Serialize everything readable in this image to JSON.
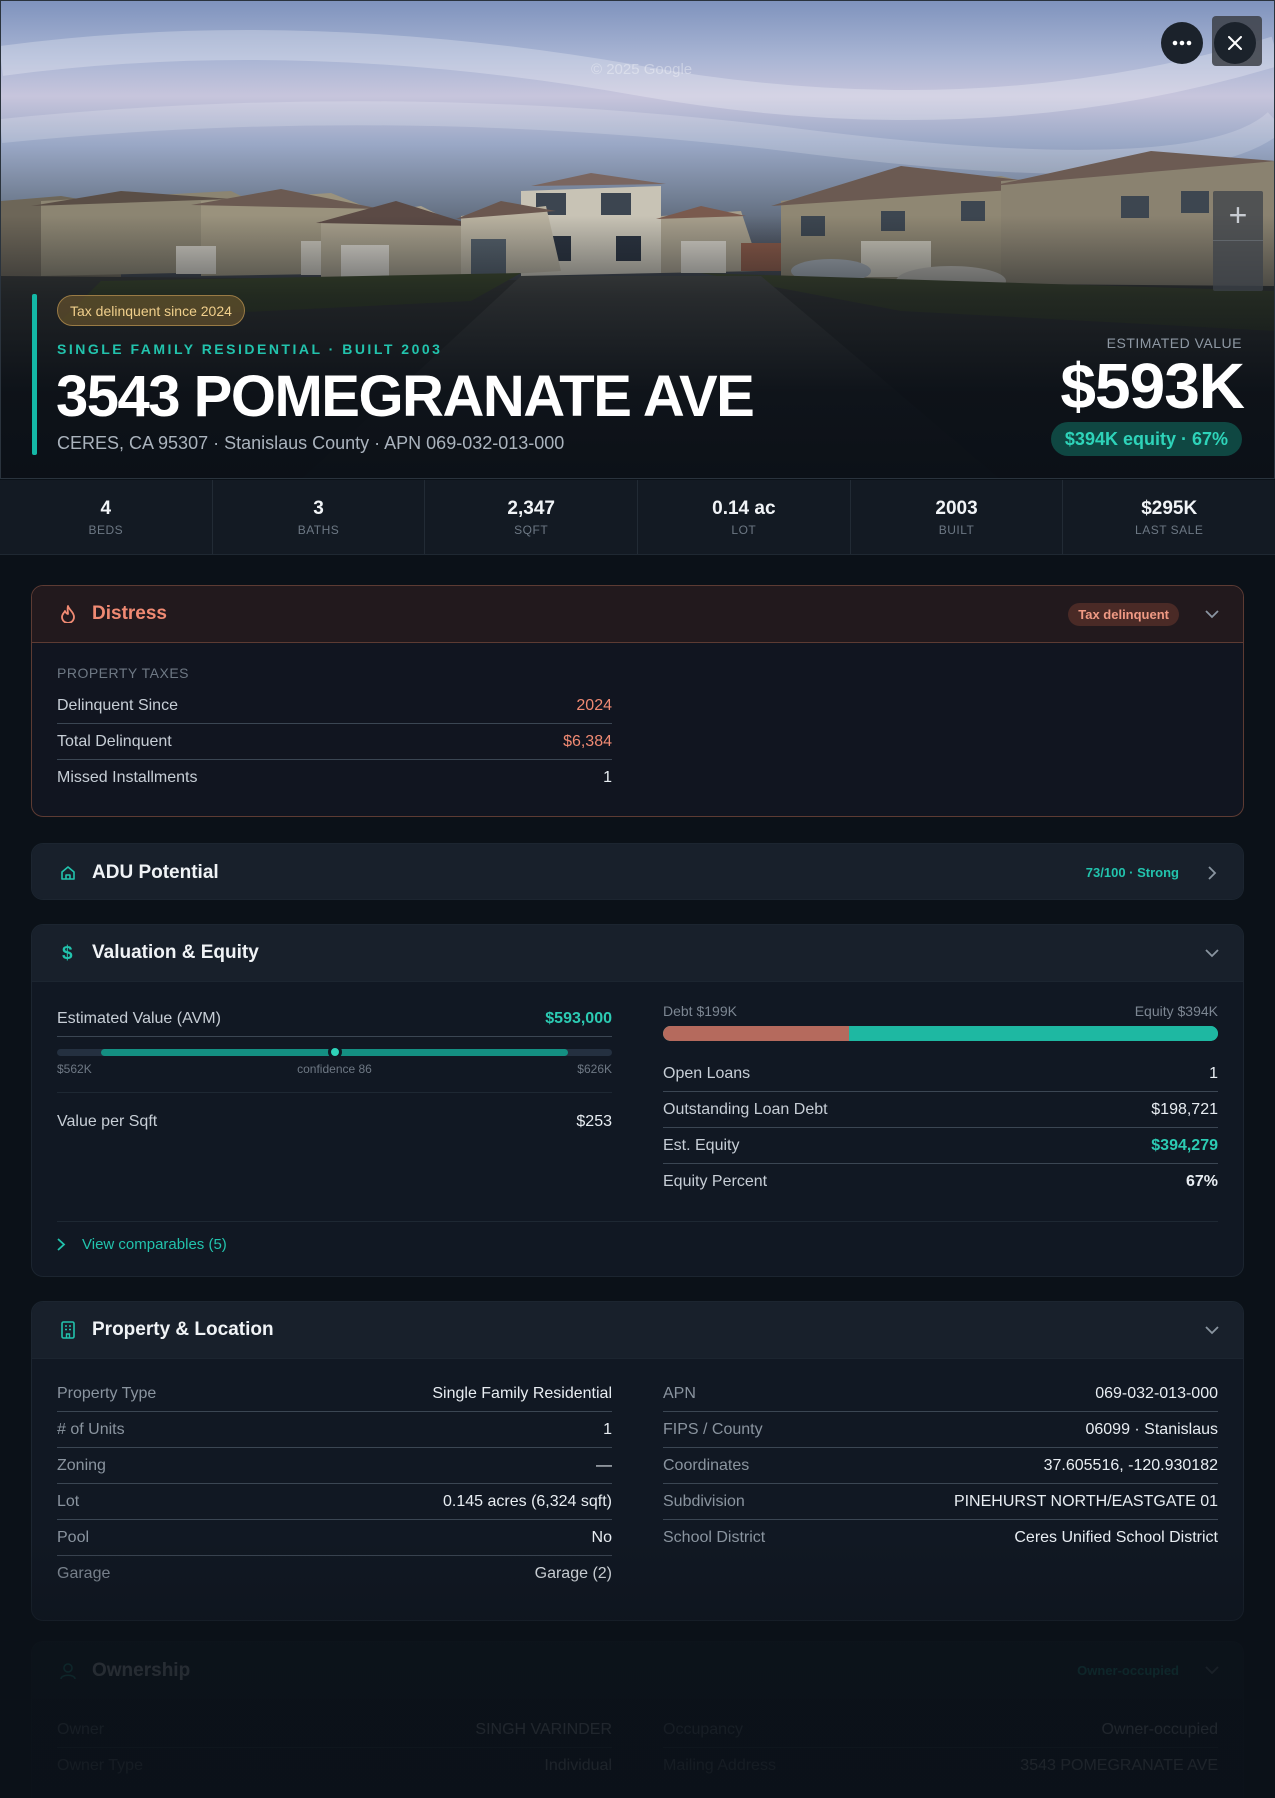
{
  "hero": {
    "watermark": "© 2025 Google",
    "tax_badge": "Tax delinquent since 2024",
    "subtype": "SINGLE FAMILY RESIDENTIAL · BUILT 2003",
    "address": "3543 POMEGRANATE AVE",
    "location_line": "CERES, CA 95307 · Stanislaus County · APN 069-032-013-000",
    "estimated_label": "ESTIMATED VALUE",
    "estimated_value": "$593K",
    "equity_pill": "$394K equity · 67%",
    "more_icon": "more-horizontal-icon",
    "close_icon": "close-icon",
    "zoom_in_label": "+"
  },
  "stats": [
    {
      "value": "4",
      "label": "BEDS"
    },
    {
      "value": "3",
      "label": "BATHS"
    },
    {
      "value": "2,347",
      "label": "SQFT"
    },
    {
      "value": "0.14 ac",
      "label": "LOT"
    },
    {
      "value": "2003",
      "label": "BUILT"
    },
    {
      "value": "$295K",
      "label": "LAST SALE"
    }
  ],
  "distress": {
    "title": "Distress",
    "badge": "Tax delinquent",
    "section_label": "PROPERTY TAXES",
    "rows": [
      {
        "label": "Delinquent Since",
        "value": "2024"
      },
      {
        "label": "Total Delinquent",
        "value": "$6,384"
      },
      {
        "label": "Missed Installments",
        "value": "1"
      }
    ]
  },
  "adu": {
    "title": "ADU Potential",
    "score": "73/100 · Strong"
  },
  "valuation": {
    "title": "Valuation & Equity",
    "avm_label": "Estimated Value (AVM)",
    "avm_value": "$593,000",
    "range_low": "$562K",
    "range_high": "$626K",
    "confidence": "confidence 86",
    "range_fill_start": 0.08,
    "range_fill_end": 0.92,
    "range_marker": 0.5,
    "value_per_sqft_label": "Value per Sqft",
    "value_per_sqft": "$253",
    "debt_label": "Debt $199K",
    "equity_label": "Equity $394K",
    "debt_fraction": 0.335,
    "right_rows": [
      {
        "label": "Open Loans",
        "value": "1"
      },
      {
        "label": "Outstanding Loan Debt",
        "value": "$198,721"
      },
      {
        "label": "Est. Equity",
        "value": "$394,279"
      },
      {
        "label": "Equity Percent",
        "value": "67%"
      }
    ],
    "view_comps": "View comparables (5)"
  },
  "property": {
    "title": "Property & Location",
    "left_rows": [
      {
        "label": "Property Type",
        "value": "Single Family Residential"
      },
      {
        "label": "# of Units",
        "value": "1"
      },
      {
        "label": "Zoning",
        "value": "—"
      },
      {
        "label": "Lot",
        "value": "0.145 acres (6,324 sqft)"
      },
      {
        "label": "Pool",
        "value": "No"
      },
      {
        "label": "Garage",
        "value": "Garage (2)"
      }
    ],
    "right_rows": [
      {
        "label": "APN",
        "value": "069-032-013-000"
      },
      {
        "label": "FIPS / County",
        "value": "06099 · Stanislaus"
      },
      {
        "label": "Coordinates",
        "value": "37.605516, -120.930182"
      },
      {
        "label": "Subdivision",
        "value": "PINEHURST NORTH/EASTGATE 01"
      },
      {
        "label": "School District",
        "value": "Ceres Unified School District"
      }
    ]
  },
  "ownership": {
    "title": "Ownership",
    "badge": "Owner-occupied",
    "left_rows": [
      {
        "label": "Owner",
        "value": "SINGH VARINDER"
      },
      {
        "label": "Owner Type",
        "value": "Individual"
      }
    ],
    "right_rows": [
      {
        "label": "Occupancy",
        "value": "Owner-occupied"
      },
      {
        "label": "Mailing Address",
        "value": "3543 POMEGRANATE AVE"
      }
    ]
  },
  "colors": {
    "accent": "#14b8a6",
    "distress": "#f08a73",
    "debt": "#b56a5d"
  }
}
